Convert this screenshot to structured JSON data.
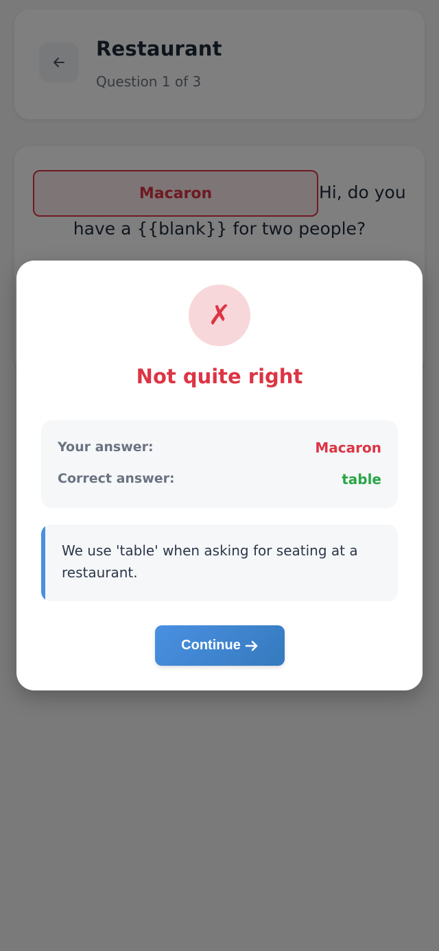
{
  "header": {
    "title": "Restaurant",
    "subtitle": "Question 1 of 3"
  },
  "question": {
    "selected_answer": "Macaron",
    "sentence_part1": "Hi, do you",
    "sentence_part2": "have a {{blank}} for two people?"
  },
  "modal": {
    "icon_glyph": "✗",
    "title": "Not quite right",
    "your_answer_label": "Your answer:",
    "your_answer_value": "Macaron",
    "correct_answer_label": "Correct answer:",
    "correct_answer_value": "table",
    "explanation": "We use 'table' when asking for seating at a restaurant.",
    "continue_label": "Continue"
  },
  "colors": {
    "wrong": "#dc3545",
    "correct": "#28a745",
    "accent": "#4a90e2"
  }
}
